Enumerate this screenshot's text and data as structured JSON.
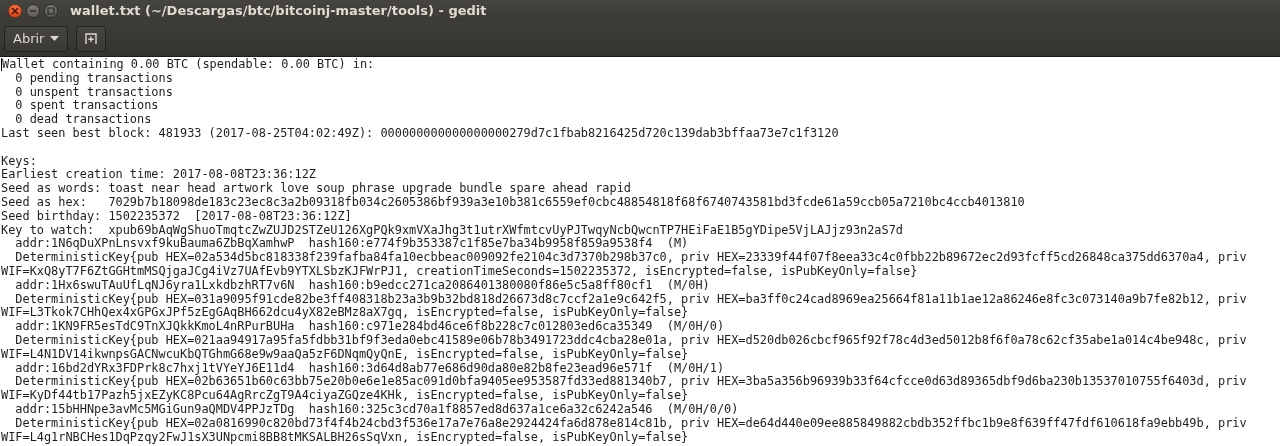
{
  "window": {
    "title": "wallet.txt (~/Descargas/btc/bitcoinj-master/tools) - gedit"
  },
  "toolbar": {
    "open_button": "Abrir"
  },
  "document": {
    "blocks": [
      [
        "Wallet containing 0.00 BTC (spendable: 0.00 BTC) in:",
        "  0 pending transactions",
        "  0 unspent transactions",
        "  0 spent transactions",
        "  0 dead transactions",
        "Last seen best block: 481933 (2017-08-25T04:02:49Z): 000000000000000000279d7c1fbab8216425d720c139dab3bffaa73e7c1f3120"
      ],
      [
        "Keys:",
        "Earliest creation time: 2017-08-08T23:36:12Z",
        "Seed as words: toast near head artwork love soup phrase upgrade bundle spare ahead rapid",
        "Seed as hex:   7029b7b18098de183c23ec8c3a2b09318fb034c2605386bf939a3e10b381c6559ef0cbc48854818f68f6740743581bd3fcde61a59ccb05a7210bc4ccb4013810",
        "Seed birthday: 1502235372  [2017-08-08T23:36:12Z]",
        "Key to watch:  xpub69bAqWgShuoTmqtcZwZUJD2STZeU126XgPQk9xmVXaJhg3t1utrXWfmtcvUyPJTwqyNcbQwcnTP7HEiFaE1B5gYDipe5VjLAJjz93n2aS7d",
        "  addr:1N6qDuXPnLnsvxf9kuBauma6ZbBqXamhwP  hash160:e774f9b353387c1f85e7ba34b9958f859a9538f4  (M)",
        "  DeterministicKey{pub HEX=02a534d5bc818338f239fafba84fa10ecbbeac009092fe2104c3d7370b298b37c0, priv HEX=23339f44f07f8eea33c4c0fbb22b89672ec2d93fcff5cd26848ca375dd6370a4, priv",
        "WIF=KxQ8yT7F6ZtGGHtmMSQjgaJCg4iVz7UAfEvb9YTXLSbzKJFWrPJ1, creationTimeSeconds=1502235372, isEncrypted=false, isPubKeyOnly=false}",
        "  addr:1Hx6swuTAuUfLqNJ6yra1LxkdbzhRT7v6N  hash160:b9edcc271ca2086401380080f86e5c5a8ff80cf1  (M/0H)",
        "  DeterministicKey{pub HEX=031a9095f91cde82be3ff408318b23a3b9b32bd818d26673d8c7ccf2a1e9c642f5, priv HEX=ba3ff0c24cad8969ea25664f81a11b1ae12a86246e8fc3c073140a9b7fe82b12, priv",
        "WIF=L3Tkok7CHhQex4xGPGxJPf5zEgGAqBH662dcu4yX82eBMz8aX7gq, isEncrypted=false, isPubKeyOnly=false}",
        "  addr:1KN9FR5esTdC9TnXJQkkKmoL4nRPurBUHa  hash160:c971e284bd46ce6f8b228c7c012803ed6ca35349  (M/0H/0)",
        "  DeterministicKey{pub HEX=021aa94917a95fa5fdbb31bf9f3eda0ebc41589e06b78b3491723ddc4cba28e01a, priv HEX=d520db026cbcf965f92f78c4d3ed5012b8f6f0a78c62cf35abe1a014c4be948c, priv",
        "WIF=L4N1DV14ikwnpsGACNwcuKbQTGhmG68e9w9aaQa5zF6DNqmQyQnE, isEncrypted=false, isPubKeyOnly=false}",
        "  addr:16bd2dYRx3FDPrk8c7hxj1tVYeYJ6E11d4  hash160:3d64d8ab77e686d90da80e82b8fe23ead96e571f  (M/0H/1)",
        "  DeterministicKey{pub HEX=02b63651b60c63bb75e20b0e6e1e85ac091d0bfa9405ee953587fd33ed881340b7, priv HEX=3ba5a356b96939b33f64cfcce0d63d89365dbf9d6ba230b13537010755f6403d, priv",
        "WIF=KyDf44tb17Pazh5jxEZyKC8Pcu64AgRrcZgT9A4ciyaZGQze4KHk, isEncrypted=false, isPubKeyOnly=false}",
        "  addr:15bHHNpe3avMc5MGiGun9aQMDV4PPJzTDg  hash160:325c3cd70a1f8857ed8d637a1ce6a32c6242a546  (M/0H/0/0)",
        "  DeterministicKey{pub HEX=02a0816990c820bd73f4f4b24cbd3f536e17a7e76a8e2924424fa6d878e814c81b, priv HEX=de64d440e09ee885849882cbdb352ffbc1b9e8f639ff47fdf610618fa9ebb49b, priv",
        "WIF=L4g1rNBCHes1DqPzqy2FwJ1sX3UNpcmi8BB8tMKSALBH26sSqVxn, isEncrypted=false, isPubKeyOnly=false}"
      ]
    ]
  }
}
